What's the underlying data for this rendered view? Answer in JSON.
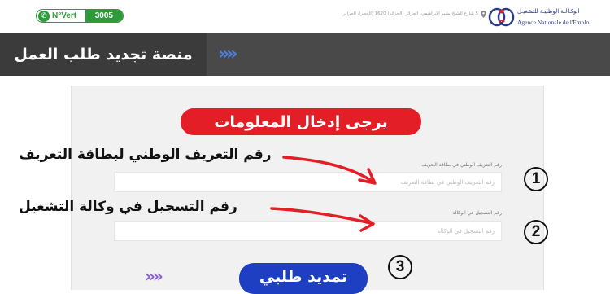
{
  "topbar": {
    "nvert_label": "N°Vert",
    "nvert_number": "3005",
    "address": "5 شارع الشيخ بشير الإبراهيمي، الجزائر (الجزائر) 1620 (الحجر)، الجزائر",
    "logo_ar": "الوكـالـة الوطنيـة للتشغيـل",
    "logo_fr": "Agence Nationale de l'Emploi"
  },
  "header": {
    "title": "منصة تجديد طلب العمل",
    "chevrons": "»»"
  },
  "form": {
    "heading": "يرجى إدخال المعلومات",
    "nin_label": "رقم التعريف الوطني في بطاقة التعريف",
    "nin_placeholder": "رقم التعريف الوطني في بطاقة التعريف",
    "agency_label": "رقم التسجيل في الوكالة",
    "agency_placeholder": "رقم التسجيل في الوكالة",
    "submit_label": "تمديد طلبي",
    "button_chevrons": "»»"
  },
  "annotations": {
    "nin_callout": "رقم التعريف الوطني لبطاقة التعريف",
    "agency_callout": "رقم التسجيل في وكالة التشغيل",
    "step1": "1",
    "step2": "2",
    "step3": "3"
  },
  "colors": {
    "header_bg": "#494949",
    "title_pill": "#e41e26",
    "submit_button": "#1f3fc2",
    "nvert_green": "#2e9a3b",
    "arrow_red": "#e41e26"
  }
}
